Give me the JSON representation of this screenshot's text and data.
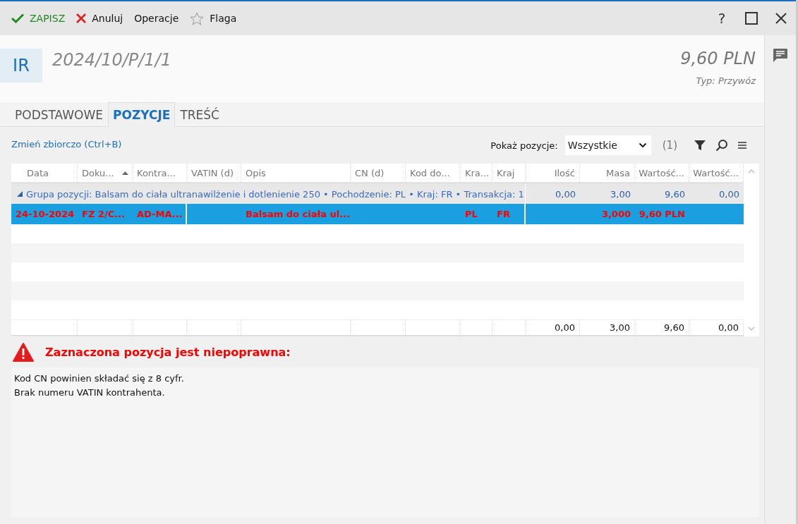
{
  "toolbar": {
    "items": [
      {
        "kind": "save",
        "label": "ZAPISZ"
      },
      {
        "kind": "cancel",
        "label": "Anuluj"
      },
      {
        "kind": "plain",
        "label": "Operacje"
      },
      {
        "kind": "flag",
        "label": "Flaga"
      }
    ],
    "help": "?"
  },
  "header": {
    "badge": "IR",
    "number": "2024/10/P/1/1",
    "amount": "9,60 PLN",
    "type": "Typ: Przywóz"
  },
  "tabs": [
    {
      "label": "PODSTAWOWE",
      "selected": false
    },
    {
      "label": "POZYCJE",
      "selected": true
    },
    {
      "label": "TREŚĆ",
      "selected": false
    }
  ],
  "bulk_link": "Zmień zbiorczo (Ctrl+B)",
  "filter": {
    "label": "Pokaż pozycje:",
    "value": "Wszystkie",
    "count": "(1)"
  },
  "table": {
    "columns": [
      {
        "label": "Data",
        "sorted": false
      },
      {
        "label": "Doku...",
        "sorted": true
      },
      {
        "label": "Kontra...",
        "sorted": false
      },
      {
        "label": "VATIN (d)",
        "sorted": false
      },
      {
        "label": "Opis",
        "sorted": false
      },
      {
        "label": "CN (d)",
        "sorted": false
      },
      {
        "label": "Kod do...",
        "sorted": false
      },
      {
        "label": "Kra...",
        "sorted": false
      },
      {
        "label": "Kraj",
        "sorted": false
      },
      {
        "label": "Ilość",
        "sorted": false
      },
      {
        "label": "Masa",
        "sorted": false
      },
      {
        "label": "Wartość...",
        "sorted": false
      },
      {
        "label": "Wartość...",
        "sorted": false
      }
    ],
    "group": {
      "label": "Grupa pozycji: Balsam do ciała ultranawilżenie i dotlenienie 250 • Pochodzenie: PL • Kraj: FR • Transakcja: 1",
      "expanded": true,
      "totals": [
        "0,00",
        "3,00",
        "9,60",
        "0,00"
      ]
    },
    "rows": [
      {
        "selected": true,
        "invalid": true,
        "cells": [
          "24-10-2024",
          "FZ 2/C...",
          "AD-MA...",
          "",
          "Balsam do ciała ul...",
          "",
          "",
          "PL",
          "FR",
          "",
          "3,000",
          "9,60 PLN",
          ""
        ]
      }
    ],
    "footer": [
      "0,00",
      "3,00",
      "9,60",
      "0,00"
    ]
  },
  "error": {
    "title": "Zaznaczona pozycja jest niepoprawna:",
    "messages": [
      "Kod CN powinien składać się z 8 cyfr.",
      "Brak numeru VATIN kontrahenta."
    ]
  }
}
